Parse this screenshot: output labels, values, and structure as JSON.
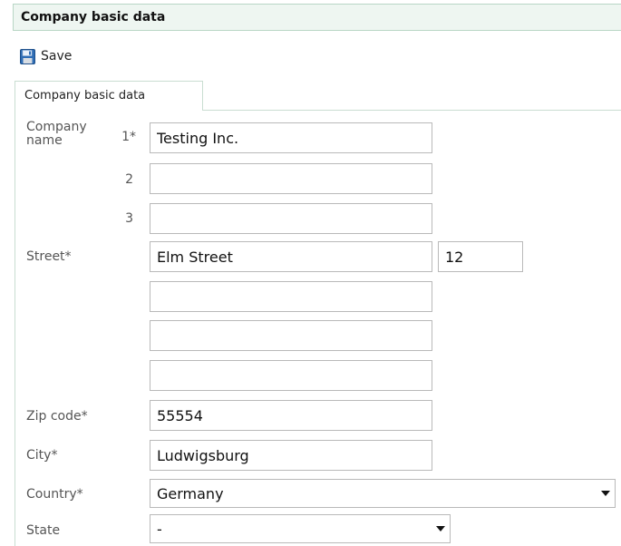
{
  "header": {
    "title": "Company basic data"
  },
  "toolbar": {
    "save_label": "Save",
    "save_icon": "floppy-disk-icon"
  },
  "tabs": [
    {
      "label": "Company basic data",
      "active": true
    }
  ],
  "form": {
    "company_name": {
      "label": "Company name",
      "lines": [
        {
          "index": "1*",
          "value": "Testing Inc."
        },
        {
          "index": "2",
          "value": ""
        },
        {
          "index": "3",
          "value": ""
        }
      ]
    },
    "street": {
      "label": "Street*",
      "value": "Elm Street",
      "number": "12",
      "extra_lines": [
        "",
        "",
        ""
      ]
    },
    "zip": {
      "label": "Zip code*",
      "value": "55554"
    },
    "city": {
      "label": "City*",
      "value": "Ludwigsburg"
    },
    "country": {
      "label": "Country*",
      "value": "Germany"
    },
    "state": {
      "label": "State",
      "value": "-"
    }
  }
}
